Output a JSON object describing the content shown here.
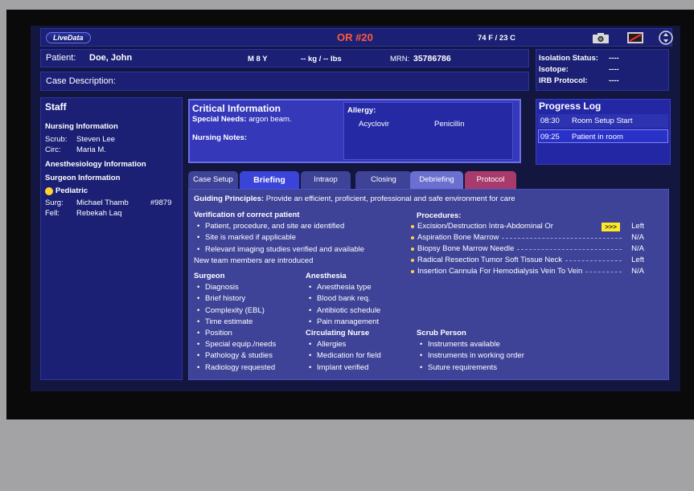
{
  "header": {
    "logo": "LiveData",
    "or_room": "OR #20",
    "temperature": "74 F / 23 C",
    "icons": [
      "camera-icon",
      "monitor-muted-icon",
      "lift-icon"
    ]
  },
  "patient": {
    "label": "Patient:",
    "name": "Doe, John",
    "sex_age": "M 8 Y",
    "weight": "-- kg / -- lbs",
    "mrn_label": "MRN:",
    "mrn": "35786786",
    "case_description_label": "Case Description:",
    "case_description": ""
  },
  "status": {
    "isolation_label": "Isolation Status:",
    "isolation_value": "----",
    "isotope_label": "Isotope:",
    "isotope_value": "----",
    "irb_label": "IRB Protocol:",
    "irb_value": "----"
  },
  "staff": {
    "title": "Staff",
    "nursing_title": "Nursing Information",
    "scrub_label": "Scrub:",
    "scrub_name": "Steven Lee",
    "circ_label": "Circ:",
    "circ_name": "Maria M.",
    "anesthesiology_title": "Anesthesiology Information",
    "surgeon_title": "Surgeon Information",
    "service": "Pediatric",
    "service_color": "#ffd42a",
    "surg_label": "Surg:",
    "surg_name": "Michael Thamb",
    "surg_id": "#9879",
    "fell_label": "Fell:",
    "fell_name": "Rebekah Laq"
  },
  "critical": {
    "title": "Critical Information",
    "special_needs_label": "Special Needs:",
    "special_needs": "argon beam.",
    "nursing_notes_label": "Nursing Notes:",
    "allergy_label": "Allergy:",
    "allergies": [
      "Acyclovir",
      "Penicillin"
    ]
  },
  "progress_log": {
    "title": "Progress Log",
    "entries": [
      {
        "time": "08:30",
        "event": "Room Setup Start"
      },
      {
        "time": "09:25",
        "event": "Patient in room"
      }
    ]
  },
  "tabs": [
    {
      "label": "Case Setup",
      "active": false
    },
    {
      "label": "Briefing",
      "active": true
    },
    {
      "label": "Intraop",
      "active": false
    },
    {
      "label": "Closing",
      "active": false
    },
    {
      "label": "Debriefing",
      "active": false
    },
    {
      "label": "Protocol",
      "active": false
    }
  ],
  "briefing": {
    "guiding_label": "Guiding Principles:",
    "guiding_text": "Provide an efficient, proficient, professional and safe environment for care",
    "verification_title": "Verification of correct patient",
    "verification_items": [
      "Patient, procedure, and site are identified",
      "Site is marked if applicable",
      "Relevant imaging studies verified and available"
    ],
    "new_team_note": "New team members are introduced",
    "procedures_title": "Procedures:",
    "procedures": [
      {
        "name": "Excision/Destruction Intra-Abdominal Or",
        "flag": ">>>",
        "side": "Left"
      },
      {
        "name": "Aspiration Bone Marrow",
        "side": "N/A"
      },
      {
        "name": "Biopsy Bone Marrow Needle",
        "side": "N/A"
      },
      {
        "name": "Radical Resection Tumor Soft Tissue Neck",
        "side": "Left"
      },
      {
        "name": "Insertion Cannula For Hemodialysis Vein To Vein",
        "side": "N/A"
      }
    ],
    "surgeon_title": "Surgeon",
    "surgeon_items": [
      "Diagnosis",
      "Brief history",
      "Complexity (EBL)",
      "Time estimate",
      "Position",
      "Special equip./needs",
      "Pathology & studies",
      "Radiology requested"
    ],
    "anesthesia_title": "Anesthesia",
    "anesthesia_items": [
      "Anesthesia type",
      "Blood bank req.",
      "Antibiotic schedule",
      "Pain management"
    ],
    "circulating_title": "Circulating Nurse",
    "circulating_items": [
      "Allergies",
      "Medication for field",
      "Implant verified"
    ],
    "scrub_title": "Scrub Person",
    "scrub_items": [
      "Instruments available",
      "Instruments in working order",
      "Suture requirements"
    ]
  }
}
